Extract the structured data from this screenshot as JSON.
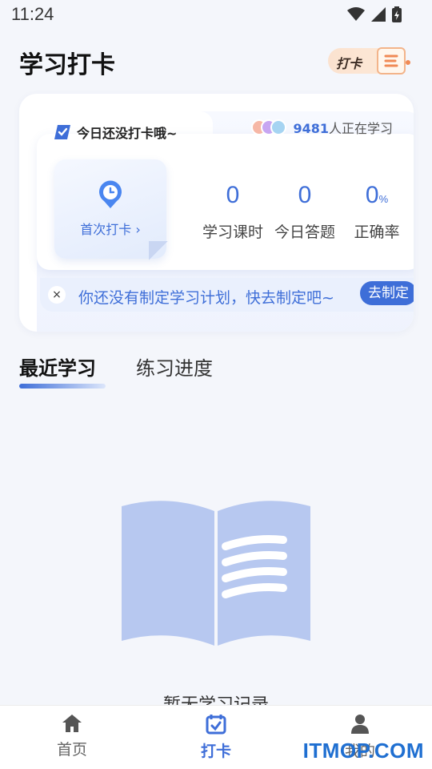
{
  "status_bar": {
    "time": "11:24"
  },
  "header": {
    "title": "学习打卡",
    "badge_label": "打卡"
  },
  "checkin_card": {
    "notice_title": "今日还没打卡哦~",
    "learners_count": "9481",
    "learners_suffix": "人正在学习",
    "ticket_label": "首次打卡 ›",
    "stats": [
      {
        "value": "0",
        "unit": "",
        "label": "学习课时"
      },
      {
        "value": "0",
        "unit": "",
        "label": "今日答题"
      },
      {
        "value": "0",
        "unit": "%",
        "label": "正确率"
      }
    ],
    "plan_notice": "你还没有制定学习计划，快去制定吧~",
    "plan_button": "去制定",
    "plan_close": "×"
  },
  "tabs": [
    {
      "label": "最近学习",
      "active": true
    },
    {
      "label": "练习进度",
      "active": false
    }
  ],
  "empty_state": {
    "text": "暂无学习记录"
  },
  "bottom_nav": [
    {
      "label": "首页",
      "icon": "home-icon",
      "active": false
    },
    {
      "label": "打卡",
      "icon": "calendar-check-icon",
      "active": true
    },
    {
      "label": "我的",
      "icon": "person-icon",
      "active": false
    }
  ],
  "watermark": "ITMOP.COM",
  "colors": {
    "accent": "#3e6ed8",
    "background": "#f4f6fb",
    "illustration": "#b7c8f0"
  }
}
